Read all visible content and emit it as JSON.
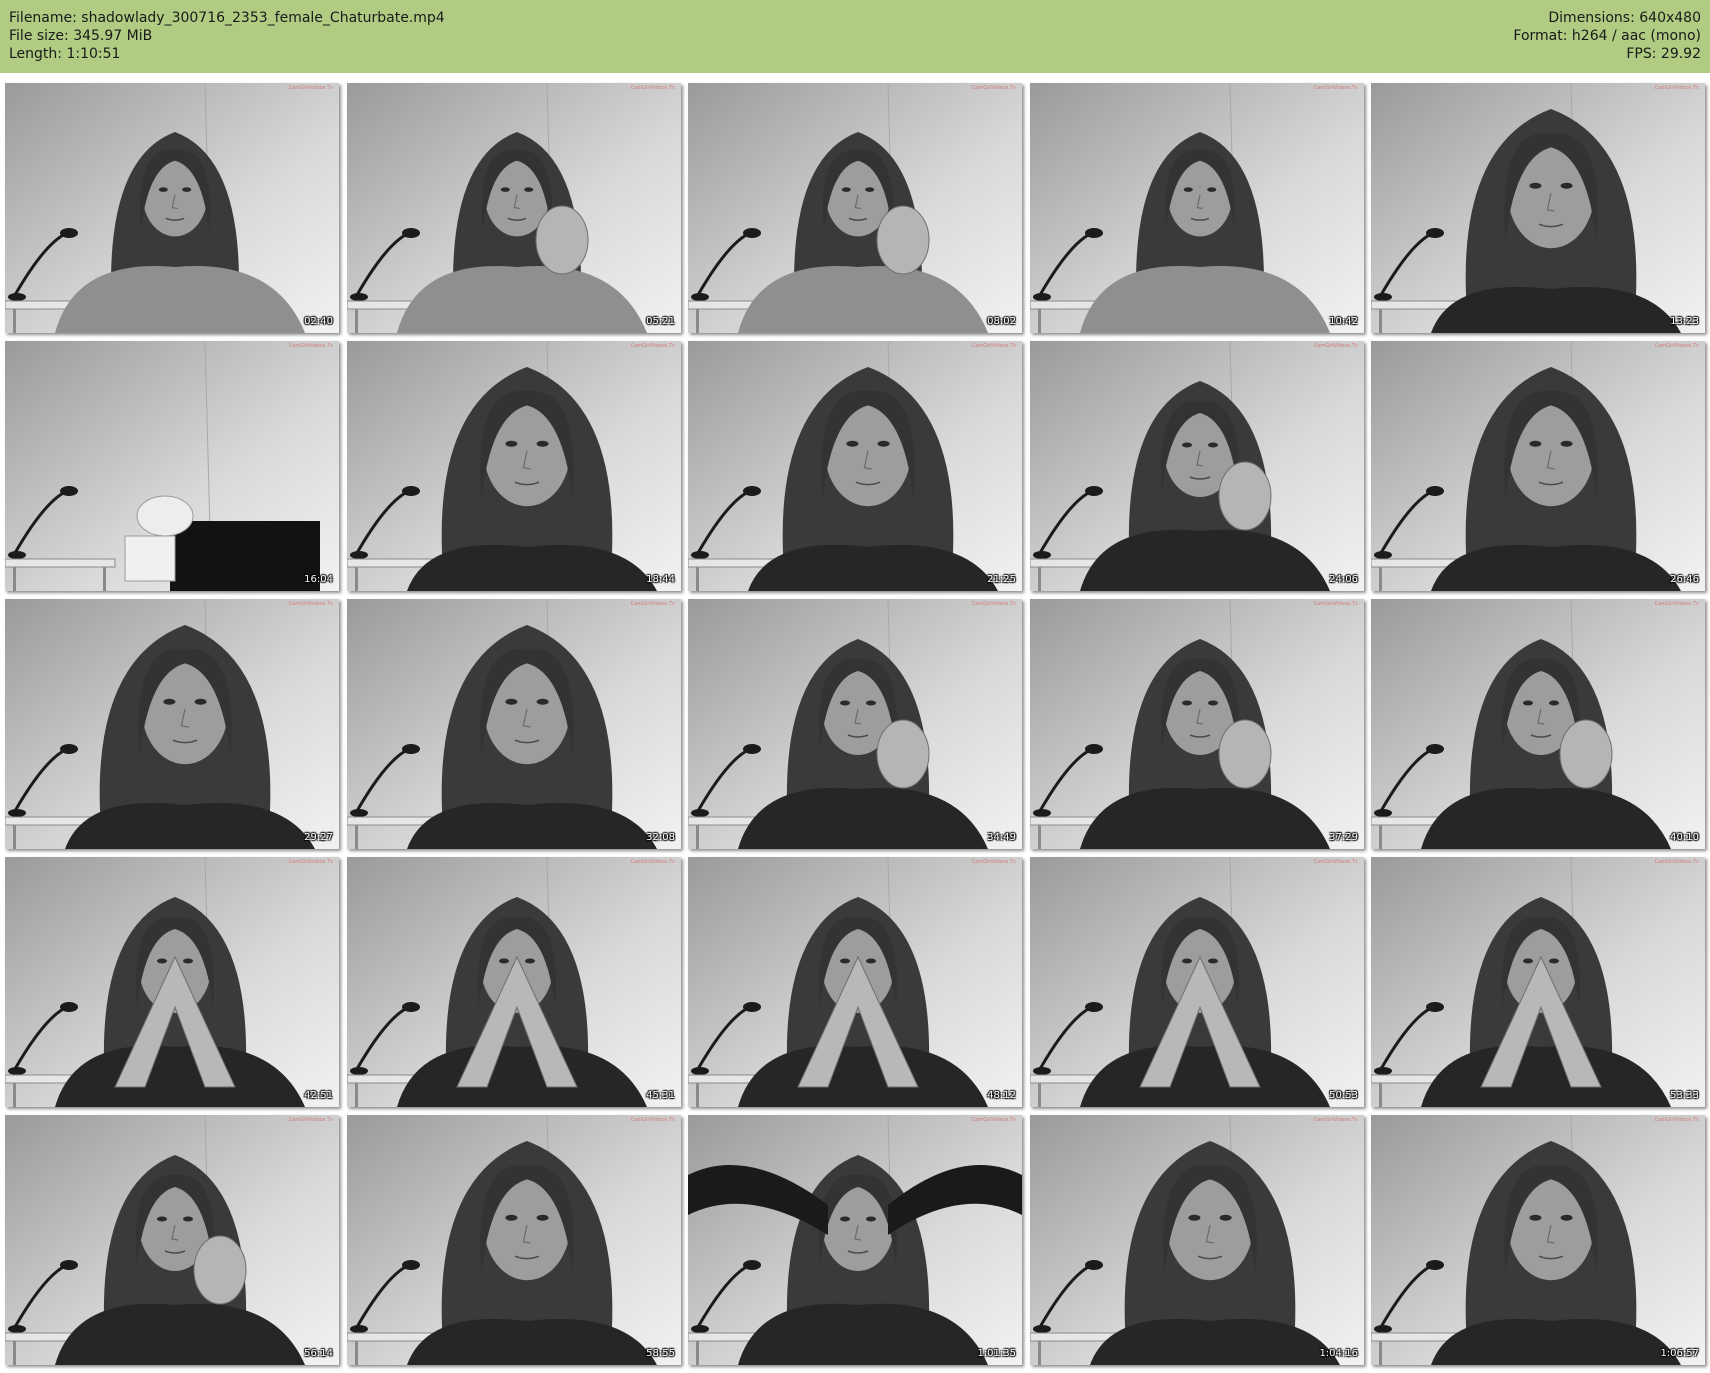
{
  "header": {
    "filename": "Filename: shadowlady_300716_2353_female_Chaturbate.mp4",
    "filesize": "File size: 345.97 MiB",
    "length": "Length: 1:10:51",
    "dimensions": "Dimensions: 640x480",
    "format": "Format: h264 / aac (mono)",
    "fps": "FPS: 29.92"
  },
  "colors": {
    "header_bg": "#afcc82",
    "page_bg": "#ffffff"
  },
  "watermark": "CamGirlVideos.Tv",
  "thumbnails": [
    {
      "time": "02:40",
      "scene": "blanket"
    },
    {
      "time": "05:21",
      "scene": "blanket-hand"
    },
    {
      "time": "08:02",
      "scene": "blanket-hand"
    },
    {
      "time": "10:42",
      "scene": "blanket"
    },
    {
      "time": "13:23",
      "scene": "close"
    },
    {
      "time": "16:04",
      "scene": "empty"
    },
    {
      "time": "18:44",
      "scene": "close"
    },
    {
      "time": "21:25",
      "scene": "close"
    },
    {
      "time": "24:06",
      "scene": "hand"
    },
    {
      "time": "26:46",
      "scene": "close"
    },
    {
      "time": "29:27",
      "scene": "close"
    },
    {
      "time": "32:08",
      "scene": "close"
    },
    {
      "time": "34:49",
      "scene": "hand"
    },
    {
      "time": "37:29",
      "scene": "hand"
    },
    {
      "time": "40:10",
      "scene": "hand"
    },
    {
      "time": "42:51",
      "scene": "hands-steeple"
    },
    {
      "time": "45:31",
      "scene": "hands-steeple"
    },
    {
      "time": "48:12",
      "scene": "hands-steeple"
    },
    {
      "time": "50:53",
      "scene": "hands-steeple"
    },
    {
      "time": "53:33",
      "scene": "hands-steeple"
    },
    {
      "time": "56:14",
      "scene": "hand"
    },
    {
      "time": "58:55",
      "scene": "close"
    },
    {
      "time": "1:01:35",
      "scene": "arms-up"
    },
    {
      "time": "1:04:16",
      "scene": "close"
    },
    {
      "time": "1:06:57",
      "scene": "close"
    }
  ]
}
